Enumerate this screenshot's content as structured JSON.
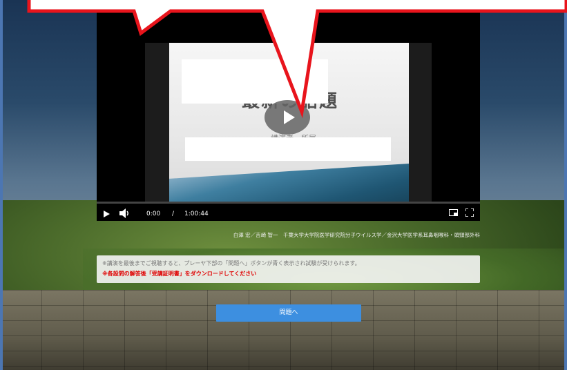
{
  "player": {
    "current_time": "0:00",
    "separator": "/",
    "duration": "1:00:44",
    "progress": 0,
    "slide_title": "最新の話題",
    "slide_subtitle": "講演者・所属"
  },
  "credit": "白澤 宏／吉崎 智一　千葉大学大学院医学研究院分子ウイルス学／金沢大学医学系耳鼻咽喉科・頭頸部外科",
  "notice": {
    "line1": "※講演を最後までご視聴すると、プレーヤ下部の「問題へ」ボタンが青く表示され試験が受けられます。",
    "line2": "※各設問の解答後「受講証明書」をダウンロードしてください"
  },
  "quiz_button": "問題へ",
  "colors": {
    "accent": "#3d8fe0",
    "warning": "#e00000",
    "callout": "#e8141c"
  },
  "icons": [
    "play-icon",
    "volume-icon",
    "picture-in-picture-icon",
    "fullscreen-icon",
    "big-play-icon"
  ]
}
